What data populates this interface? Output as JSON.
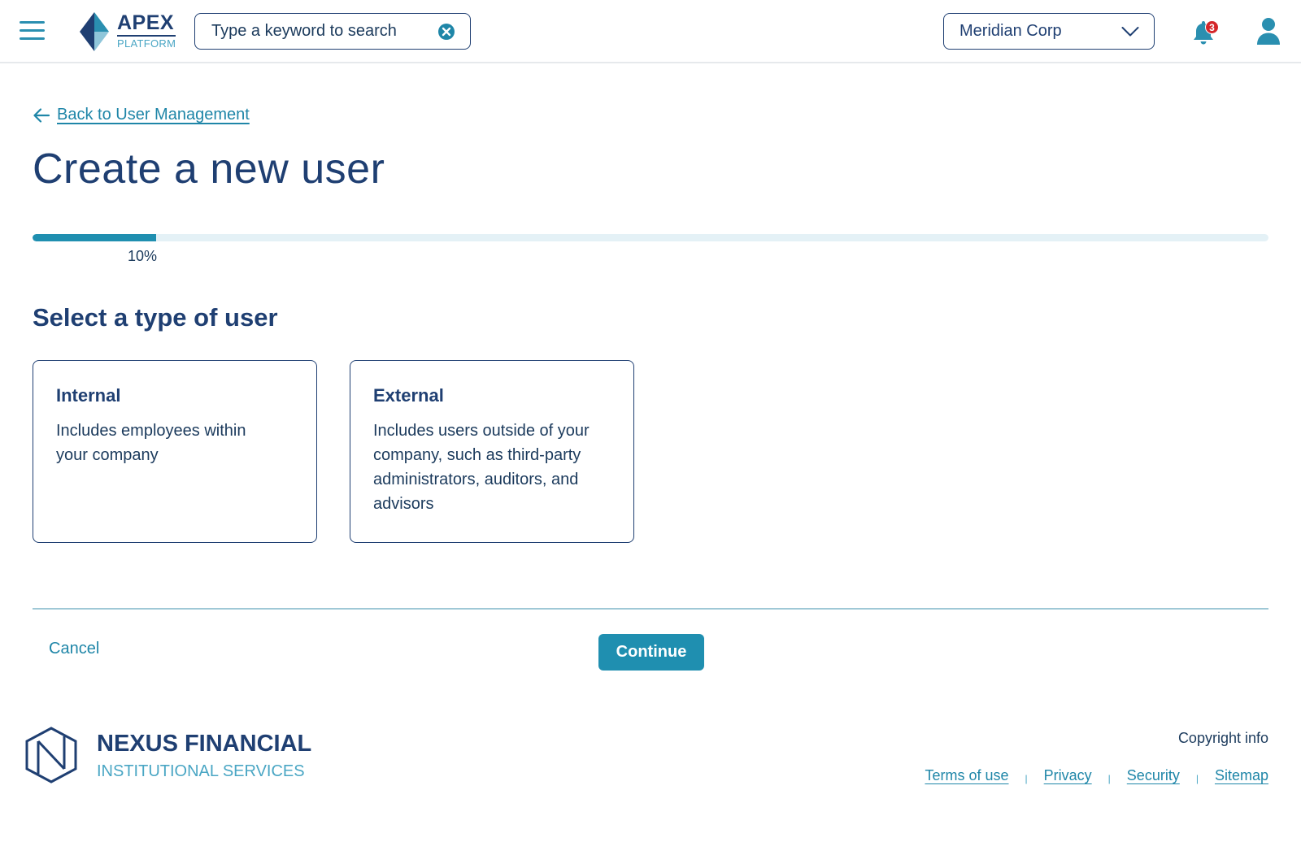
{
  "header": {
    "menu_icon": "hamburger-menu-icon",
    "logo": {
      "name": "APEX",
      "sub": "PLATFORM"
    },
    "search": {
      "placeholder": "Type a keyword to search",
      "value": "",
      "clear_icon": "clear-circle-icon"
    },
    "org_selector": {
      "selected": "Meridian Corp",
      "icon": "chevron-down-icon"
    },
    "notifications": {
      "icon": "bell-icon",
      "count": "3"
    },
    "account": {
      "icon": "user-icon"
    }
  },
  "main": {
    "back_link": {
      "label": "Back to User Management",
      "icon": "arrow-left-icon"
    },
    "title": "Create a new user",
    "progress": {
      "value": 0.1,
      "label": "10%"
    },
    "section_title": "Select a type of user",
    "user_types": [
      {
        "title": "Internal",
        "description": "Includes employees within your company"
      },
      {
        "title": "External",
        "description": "Includes users outside of your company, such as third-party administrators, auditors, and advisors"
      }
    ],
    "actions": {
      "cancel_label": "Cancel",
      "continue_label": "Continue"
    }
  },
  "footer": {
    "brand": {
      "name": "NEXUS FINANCIAL",
      "sub": "INSTITUTIONAL SERVICES",
      "icon": "hexagon-n-logo-icon"
    },
    "copyright": "Copyright info",
    "links": [
      "Terms of use",
      "Privacy",
      "Security",
      "Sitemap"
    ]
  },
  "colors": {
    "primary": "#1f8fb0",
    "navy": "#1f3f72",
    "accent_light": "#4aa6c4",
    "badge": "#d4262a"
  }
}
